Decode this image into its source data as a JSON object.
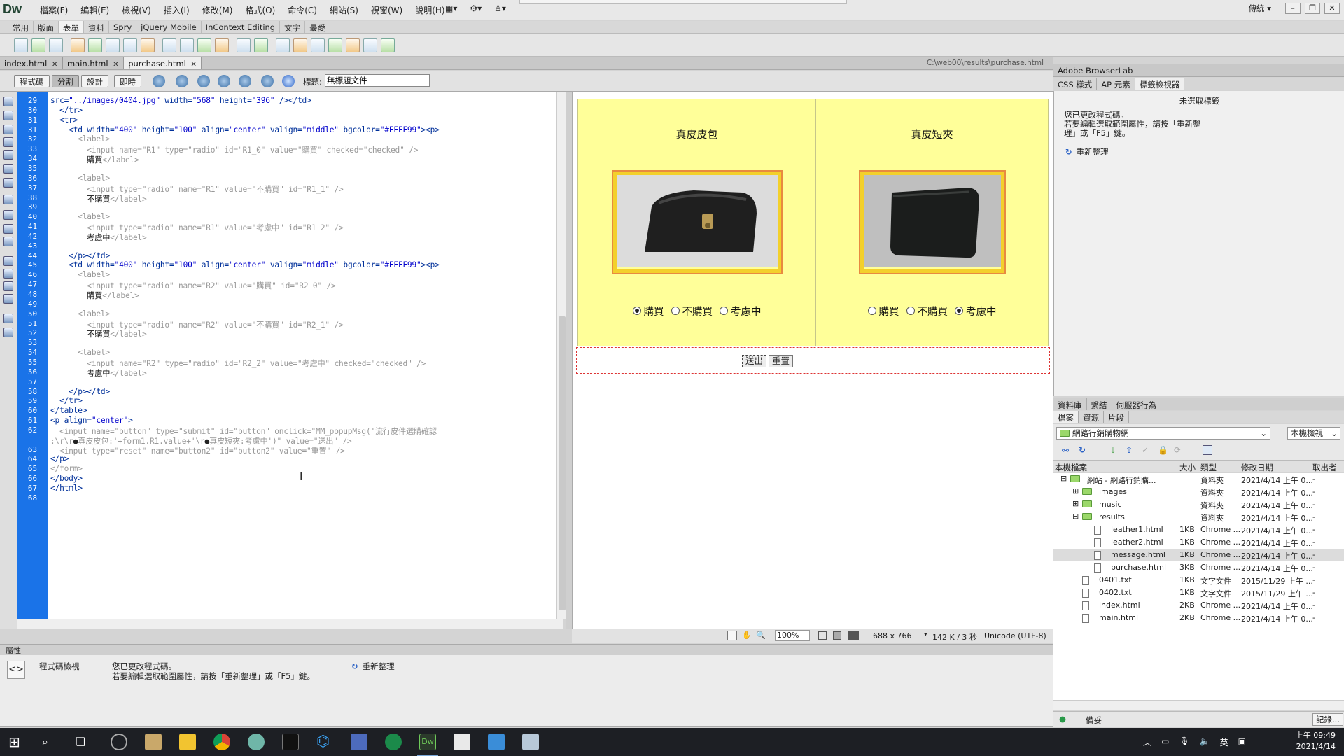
{
  "app": {
    "logo": "Dw",
    "layout_menu": "傳統 ▾"
  },
  "menu": [
    "檔案(F)",
    "編輯(E)",
    "檢視(V)",
    "插入(I)",
    "修改(M)",
    "格式(O)",
    "命令(C)",
    "網站(S)",
    "視窗(W)",
    "說明(H)"
  ],
  "menu_tools": [
    "▦▾",
    "⚙▾",
    "♙▾"
  ],
  "insert_tabs": [
    "常用",
    "版面",
    "表單",
    "資料",
    "Spry",
    "jQuery Mobile",
    "InContext Editing",
    "文字",
    "最愛"
  ],
  "insert_active": "表單",
  "doc_tabs": [
    {
      "label": "index.html",
      "active": false
    },
    {
      "label": "main.html",
      "active": false
    },
    {
      "label": "purchase.html",
      "active": true
    }
  ],
  "doc_path": "C:\\web00\\results\\purchase.html",
  "view_buttons": [
    "程式碼",
    "分割",
    "設計",
    "即時"
  ],
  "title_label": "標題:",
  "title_value": "無標題文件",
  "code_lines": [
    {
      "n": "29",
      "html": "<span class='att'>src=</span><span class='str'>\"../images/0404.jpg\"</span> <span class='att'>width=</span><span class='str'>\"568\"</span> <span class='att'>height=</span><span class='str'>\"396\"</span> <span class='tag'>/&gt;&lt;/td&gt;</span>"
    },
    {
      "n": "30",
      "html": "  <span class='tag'>&lt;/tr&gt;</span>"
    },
    {
      "n": "31",
      "html": "  <span class='tag'>&lt;tr&gt;</span>"
    },
    {
      "n": "31",
      "html": "    <span class='tag'>&lt;td</span> <span class='att'>width=</span><span class='str'>\"400\"</span> <span class='att'>height=</span><span class='str'>\"100\"</span> <span class='att'>align=</span><span class='str'>\"center\"</span> <span class='att'>valign=</span><span class='str'>\"middle\"</span> <span class='att'>bgcolor=</span><span class='str'>\"#FFFF99\"</span><span class='tag'>&gt;&lt;p&gt;</span>"
    },
    {
      "n": "32",
      "html": "      <span class='gry'>&lt;label&gt;</span>"
    },
    {
      "n": "33",
      "html": "        <span class='gry'>&lt;input name=\"R1\" type=\"radio\" id=\"R1_0\" value=\"購買\" checked=\"checked\" /&gt;</span>"
    },
    {
      "n": "34",
      "html": "        <span class='txt'>購買</span><span class='gry'>&lt;/label&gt;</span>"
    },
    {
      "n": "35",
      "html": ""
    },
    {
      "n": "36",
      "html": "      <span class='gry'>&lt;label&gt;</span>"
    },
    {
      "n": "37",
      "html": "        <span class='gry'>&lt;input type=\"radio\" name=\"R1\" value=\"不購買\" id=\"R1_1\" /&gt;</span>"
    },
    {
      "n": "38",
      "html": "        <span class='txt'>不購買</span><span class='gry'>&lt;/label&gt;</span>"
    },
    {
      "n": "39",
      "html": ""
    },
    {
      "n": "40",
      "html": "      <span class='gry'>&lt;label&gt;</span>"
    },
    {
      "n": "41",
      "html": "        <span class='gry'>&lt;input type=\"radio\" name=\"R1\" value=\"考慮中\" id=\"R1_2\" /&gt;</span>"
    },
    {
      "n": "42",
      "html": "        <span class='txt'>考慮中</span><span class='gry'>&lt;/label&gt;</span>"
    },
    {
      "n": "43",
      "html": ""
    },
    {
      "n": "44",
      "html": "    <span class='tag'>&lt;/p&gt;&lt;/td&gt;</span>"
    },
    {
      "n": "45",
      "html": "    <span class='tag'>&lt;td</span> <span class='att'>width=</span><span class='str'>\"400\"</span> <span class='att'>height=</span><span class='str'>\"100\"</span> <span class='att'>align=</span><span class='str'>\"center\"</span> <span class='att'>valign=</span><span class='str'>\"middle\"</span> <span class='att'>bgcolor=</span><span class='str'>\"#FFFF99\"</span><span class='tag'>&gt;&lt;p&gt;</span>"
    },
    {
      "n": "46",
      "html": "      <span class='gry'>&lt;label&gt;</span>"
    },
    {
      "n": "47",
      "html": "        <span class='gry'>&lt;input type=\"radio\" name=\"R2\" value=\"購買\" id=\"R2_0\" /&gt;</span>"
    },
    {
      "n": "48",
      "html": "        <span class='txt'>購買</span><span class='gry'>&lt;/label&gt;</span>"
    },
    {
      "n": "49",
      "html": ""
    },
    {
      "n": "50",
      "html": "      <span class='gry'>&lt;label&gt;</span>"
    },
    {
      "n": "51",
      "html": "        <span class='gry'>&lt;input type=\"radio\" name=\"R2\" value=\"不購買\" id=\"R2_1\" /&gt;</span>"
    },
    {
      "n": "52",
      "html": "        <span class='txt'>不購買</span><span class='gry'>&lt;/label&gt;</span>"
    },
    {
      "n": "53",
      "html": ""
    },
    {
      "n": "54",
      "html": "      <span class='gry'>&lt;label&gt;</span>"
    },
    {
      "n": "55",
      "html": "        <span class='gry'>&lt;input name=\"R2\" type=\"radio\" id=\"R2_2\" value=\"考慮中\" checked=\"checked\" /&gt;</span>"
    },
    {
      "n": "56",
      "html": "        <span class='txt'>考慮中</span><span class='gry'>&lt;/label&gt;</span>"
    },
    {
      "n": "57",
      "html": ""
    },
    {
      "n": "58",
      "html": "    <span class='tag'>&lt;/p&gt;&lt;/td&gt;</span>"
    },
    {
      "n": "59",
      "html": "  <span class='tag'>&lt;/tr&gt;</span>"
    },
    {
      "n": "60",
      "html": "<span class='tag'>&lt;/table&gt;</span>"
    },
    {
      "n": "61",
      "html": "<span class='tag'>&lt;p</span> <span class='att'>align=</span><span class='str'>\"center\"</span><span class='tag'>&gt;</span>"
    },
    {
      "n": "62",
      "html": "  <span class='gry'>&lt;input name=\"button\" type=\"submit\" id=\"button\" onclick=\"MM_popupMsg('流行皮件選購確認</span>"
    },
    {
      "n": "",
      "html": "<span class='gry'>:\\r\\r</span>●<span class='gry'>真皮皮包:'+form1.R1.value+'\\r</span>●<span class='gry'>真皮短夾:考慮中')\" value=\"送出\" /&gt;</span>"
    },
    {
      "n": "63",
      "html": "  <span class='gry'>&lt;input type=\"reset\" name=\"button2\" id=\"button2\" value=\"重置\" /&gt;</span>"
    },
    {
      "n": "64",
      "html": "<span class='tag'>&lt;/p&gt;</span>"
    },
    {
      "n": "65",
      "html": "<span class='gry'>&lt;/form&gt;</span>"
    },
    {
      "n": "66",
      "html": "<span class='tag'>&lt;/body&gt;</span>"
    },
    {
      "n": "67",
      "html": "<span class='tag'>&lt;/html&gt;</span>"
    },
    {
      "n": "68",
      "html": ""
    }
  ],
  "design": {
    "products": [
      {
        "name": "真皮皮包",
        "selected": "購買"
      },
      {
        "name": "真皮短夾",
        "selected": "考慮中"
      }
    ],
    "options": [
      "購買",
      "不購買",
      "考慮中"
    ],
    "submit_label": "送出",
    "reset_label": "重置"
  },
  "design_status": {
    "zoom": "100%",
    "size": "688 x 766",
    "download": "142 K / 3 秒",
    "encoding": "Unicode (UTF-8)"
  },
  "properties": {
    "header": "屬性",
    "mode": "程式碼檢視",
    "msg1": "您已更改程式碼。",
    "msg2": "若要編輯選取範圍屬性，請按「重新整理」或「F5」鍵。",
    "refresh": "重新整理"
  },
  "right_panel": {
    "title": "Adobe BrowserLab",
    "tabs": [
      "CSS 樣式",
      "AP 元素",
      "標籤檢視器"
    ],
    "active_tab": "標籤檢視器",
    "no_tag": "未選取標籤",
    "msg1": "您已更改程式碼。",
    "msg2a": "若要編輯選取範圍屬性，請按「重新整",
    "msg2b": "理」或「F5」鍵。",
    "refresh": "重新整理"
  },
  "files_panel": {
    "tabs1": [
      "資料庫",
      "繫結",
      "伺服器行為"
    ],
    "tabs2": [
      "檔案",
      "資源",
      "片段"
    ],
    "site": "網路行銷購物網",
    "view": "本機檢視",
    "headers": [
      "本機檔案",
      "大小",
      "類型",
      "修改日期",
      "取出者"
    ],
    "rows": [
      {
        "name": "網站 - 網路行銷購...",
        "size": "",
        "type": "資料夾",
        "date": "2021/4/14 上午 0...",
        "co": "-",
        "indent": 0,
        "kind": "folder",
        "exp": "⊟"
      },
      {
        "name": "images",
        "size": "",
        "type": "資料夾",
        "date": "2021/4/14 上午 0...",
        "co": "-",
        "indent": 1,
        "kind": "folder",
        "exp": "⊞"
      },
      {
        "name": "music",
        "size": "",
        "type": "資料夾",
        "date": "2021/4/14 上午 0...",
        "co": "-",
        "indent": 1,
        "kind": "folder",
        "exp": "⊞"
      },
      {
        "name": "results",
        "size": "",
        "type": "資料夾",
        "date": "2021/4/14 上午 0...",
        "co": "-",
        "indent": 1,
        "kind": "folder",
        "exp": "⊟"
      },
      {
        "name": "leather1.html",
        "size": "1KB",
        "type": "Chrome ...",
        "date": "2021/4/14 上午 0...",
        "co": "-",
        "indent": 2,
        "kind": "file",
        "exp": ""
      },
      {
        "name": "leather2.html",
        "size": "1KB",
        "type": "Chrome ...",
        "date": "2021/4/14 上午 0...",
        "co": "-",
        "indent": 2,
        "kind": "file",
        "exp": ""
      },
      {
        "name": "message.html",
        "size": "1KB",
        "type": "Chrome ...",
        "date": "2021/4/14 上午 0...",
        "co": "-",
        "indent": 2,
        "kind": "file",
        "exp": "",
        "sel": true
      },
      {
        "name": "purchase.html",
        "size": "3KB",
        "type": "Chrome ...",
        "date": "2021/4/14 上午 0...",
        "co": "-",
        "indent": 2,
        "kind": "file",
        "exp": ""
      },
      {
        "name": "0401.txt",
        "size": "1KB",
        "type": "文字文件",
        "date": "2015/11/29 上午 ...",
        "co": "-",
        "indent": 1,
        "kind": "file",
        "exp": ""
      },
      {
        "name": "0402.txt",
        "size": "1KB",
        "type": "文字文件",
        "date": "2015/11/29 上午 ...",
        "co": "-",
        "indent": 1,
        "kind": "file",
        "exp": ""
      },
      {
        "name": "index.html",
        "size": "2KB",
        "type": "Chrome ...",
        "date": "2021/4/14 上午 0...",
        "co": "-",
        "indent": 1,
        "kind": "file",
        "exp": ""
      },
      {
        "name": "main.html",
        "size": "2KB",
        "type": "Chrome ...",
        "date": "2021/4/14 上午 0...",
        "co": "-",
        "indent": 1,
        "kind": "file",
        "exp": ""
      }
    ],
    "footer_status": "備妥",
    "footer_log": "記錄..."
  },
  "taskbar": {
    "time": "上午 09:49",
    "date": "2021/4/14",
    "ime": "英"
  }
}
